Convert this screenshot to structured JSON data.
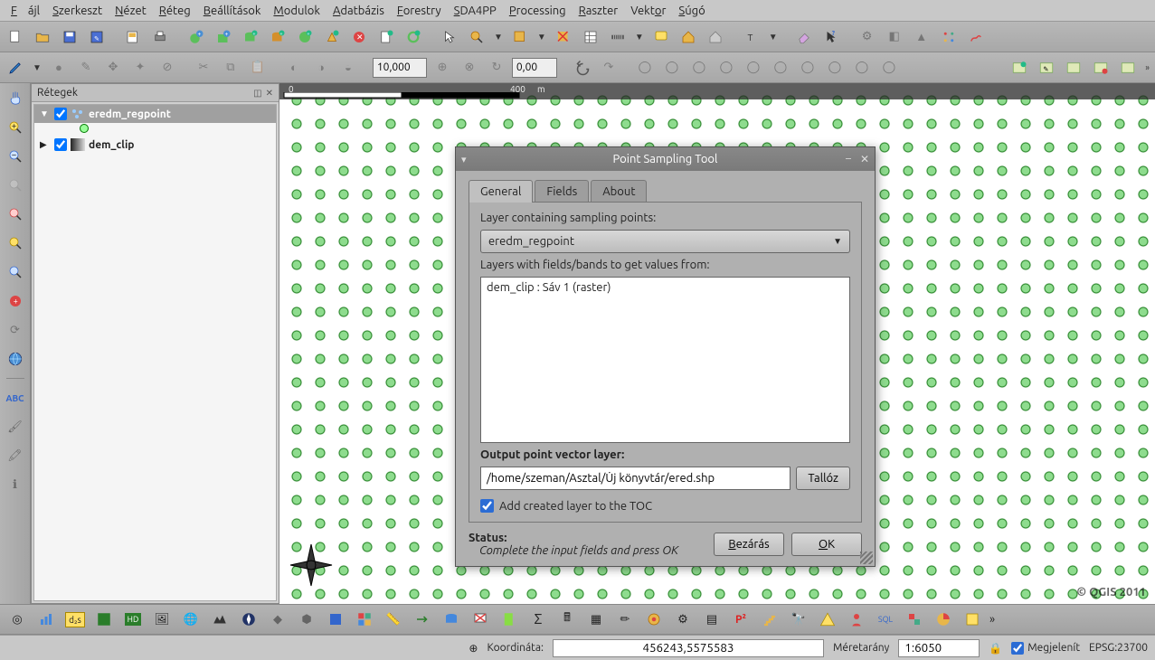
{
  "menu": {
    "items": [
      "Fájl",
      "Szerkeszt",
      "Nézet",
      "Réteg",
      "Beállítások",
      "Modulok",
      "Adatbázis",
      "Forestry",
      "SDA4PP",
      "Processing",
      "Raszter",
      "Vektor",
      "Súgó"
    ]
  },
  "toolbar1": {
    "scale_input": "10,000",
    "rot_input": "0,00"
  },
  "left_tools": [
    "hand",
    "zoom-in",
    "zoom-out",
    "zoom-grey",
    "zoom-red",
    "zoom-yellow",
    "select-blue",
    "add-red",
    "ruler",
    "globe",
    "—",
    "abc",
    "brush1",
    "brush2",
    "info"
  ],
  "layers_panel": {
    "title": "Rétegek",
    "items": [
      {
        "name": "eredm_regpoint",
        "expanded": true,
        "checked": true,
        "icon": "points",
        "selected": true
      },
      {
        "name": "dem_clip",
        "expanded": false,
        "checked": true,
        "icon": "raster",
        "selected": false
      }
    ]
  },
  "canvas": {
    "ruler_labels": [
      "0",
      "400"
    ],
    "ruler_unit": "m",
    "copyright": "© QGIS 2011"
  },
  "dialog": {
    "title": "Point Sampling Tool",
    "tabs": [
      "General",
      "Fields",
      "About"
    ],
    "active_tab": 0,
    "label_sampling": "Layer containing sampling points:",
    "combo_value": "eredm_regpoint",
    "label_sources": "Layers with fields/bands to get values from:",
    "list_items": [
      "dem_clip : Sáv 1 (raster)"
    ],
    "label_output": "Output point vector layer:",
    "output_path": "/home/szeman/Asztal/Új könyvtár/ered.shp",
    "browse": "Tallóz",
    "add_toc_label": "Add created layer to the TOC",
    "add_toc_checked": true,
    "status_label": "Status:",
    "status_text": "Complete the input fields and press OK",
    "btn_close": "Bezárás",
    "btn_ok": "OK"
  },
  "statusbar": {
    "coord_label": "Koordináta:",
    "coord_value": "456243,5575583",
    "scale_label": "Méretarány",
    "scale_value": "1:6050",
    "render_label": "Megjelenít",
    "render_checked": true,
    "epsg": "EPSG:23700"
  }
}
